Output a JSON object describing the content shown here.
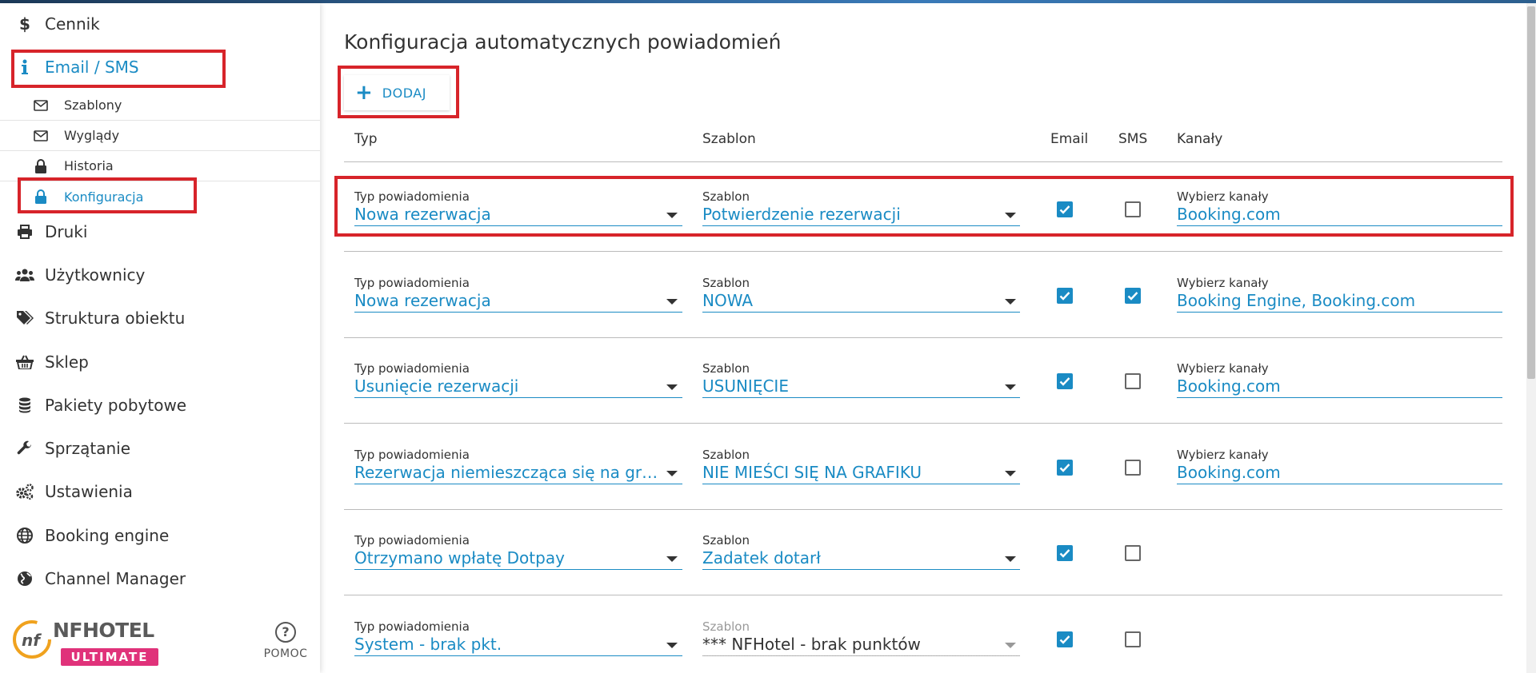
{
  "sidebar": {
    "items": [
      {
        "label": "Cennik",
        "icon": "dollar-icon"
      },
      {
        "label": "Email / SMS",
        "icon": "info-icon"
      },
      {
        "label": "Druki",
        "icon": "printer-icon"
      },
      {
        "label": "Użytkownicy",
        "icon": "users-icon"
      },
      {
        "label": "Struktura obiektu",
        "icon": "tags-icon"
      },
      {
        "label": "Sklep",
        "icon": "basket-icon"
      },
      {
        "label": "Pakiety pobytowe",
        "icon": "database-icon"
      },
      {
        "label": "Sprzątanie",
        "icon": "wrench-icon"
      },
      {
        "label": "Ustawienia",
        "icon": "gears-icon"
      },
      {
        "label": "Booking engine",
        "icon": "globe-icon"
      },
      {
        "label": "Channel Manager",
        "icon": "globe-half-icon"
      }
    ],
    "subitems": [
      {
        "label": "Szablony",
        "icon": "envelope-icon"
      },
      {
        "label": "Wyglądy",
        "icon": "envelope-icon"
      },
      {
        "label": "Historia",
        "icon": "lock-icon"
      },
      {
        "label": "Konfiguracja",
        "icon": "lock-icon"
      }
    ],
    "logo": {
      "name": "NFHOTEL",
      "badge": "ULTIMATE"
    },
    "help_label": "POMOC"
  },
  "colors": {
    "accent": "#1a8bc4",
    "highlight": "#d7242a",
    "badge": "#e0327a"
  },
  "main": {
    "title": "Konfiguracja automatycznych powiadomień",
    "add_label": "DODAJ",
    "columns": {
      "typ": "Typ",
      "szablon": "Szablon",
      "email": "Email",
      "sms": "SMS",
      "kanaly": "Kanały"
    },
    "rows": [
      {
        "typ_label": "Typ powiadomienia",
        "typ": "Nowa rezerwacja",
        "szablon_label": "Szablon",
        "szablon": "Potwierdzenie rezerwacji",
        "email": true,
        "sms": false,
        "kanaly_label": "Wybierz kanały",
        "kanaly": "Booking.com"
      },
      {
        "typ_label": "Typ powiadomienia",
        "typ": "Nowa rezerwacja",
        "szablon_label": "Szablon",
        "szablon": "NOWA",
        "email": true,
        "sms": true,
        "kanaly_label": "Wybierz kanały",
        "kanaly": "Booking Engine, Booking.com"
      },
      {
        "typ_label": "Typ powiadomienia",
        "typ": "Usunięcie rezerwacji",
        "szablon_label": "Szablon",
        "szablon": "USUNIĘCIE",
        "email": true,
        "sms": false,
        "kanaly_label": "Wybierz kanały",
        "kanaly": "Booking.com"
      },
      {
        "typ_label": "Typ powiadomienia",
        "typ": "Rezerwacja niemieszcząca się na gra...",
        "szablon_label": "Szablon",
        "szablon": "NIE MIEŚCI SIĘ NA GRAFIKU",
        "email": true,
        "sms": false,
        "kanaly_label": "Wybierz kanały",
        "kanaly": "Booking.com"
      },
      {
        "typ_label": "Typ powiadomienia",
        "typ": "Otrzymano wpłatę Dotpay",
        "szablon_label": "Szablon",
        "szablon": "Zadatek dotarł",
        "email": true,
        "sms": false
      },
      {
        "typ_label": "Typ powiadomienia",
        "typ": "System - brak pkt.",
        "szablon_label": "Szablon",
        "szablon": "*** NFHotel - brak punktów",
        "email": true,
        "sms": false,
        "szablon_disabled": true
      }
    ]
  }
}
